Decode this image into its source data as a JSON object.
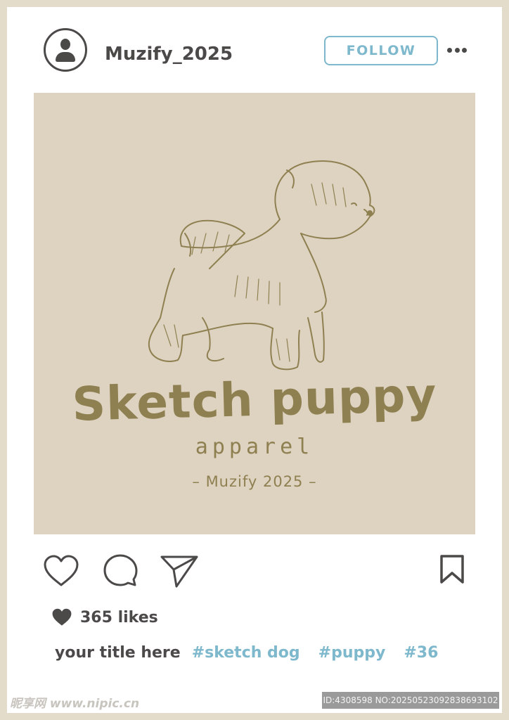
{
  "header": {
    "username": "Muzify_2025",
    "follow_label": "FOLLOW"
  },
  "post": {
    "brand_title": "Sketch puppy",
    "brand_subtitle": "apparel",
    "brand_credit": "– Muzify 2025 –"
  },
  "actions": {
    "like_icon": "heart-outline-icon",
    "comment_icon": "speech-bubble-icon",
    "share_icon": "paper-plane-icon",
    "save_icon": "bookmark-icon"
  },
  "likes": {
    "text": "365 likes"
  },
  "caption": {
    "title": "your title here",
    "tags": [
      "#sketch dog",
      "#puppy",
      "#36"
    ]
  },
  "watermark": {
    "site": "昵享网 www.nipic.cn",
    "id_text": "ID:4308598 NO:20250523092838693102"
  },
  "colors": {
    "frame": "#e4dccb",
    "dark": "#4b4a48",
    "accent": "#7eb8cc",
    "post_bg": "#ddd3c0",
    "brand": "#8f8052"
  }
}
